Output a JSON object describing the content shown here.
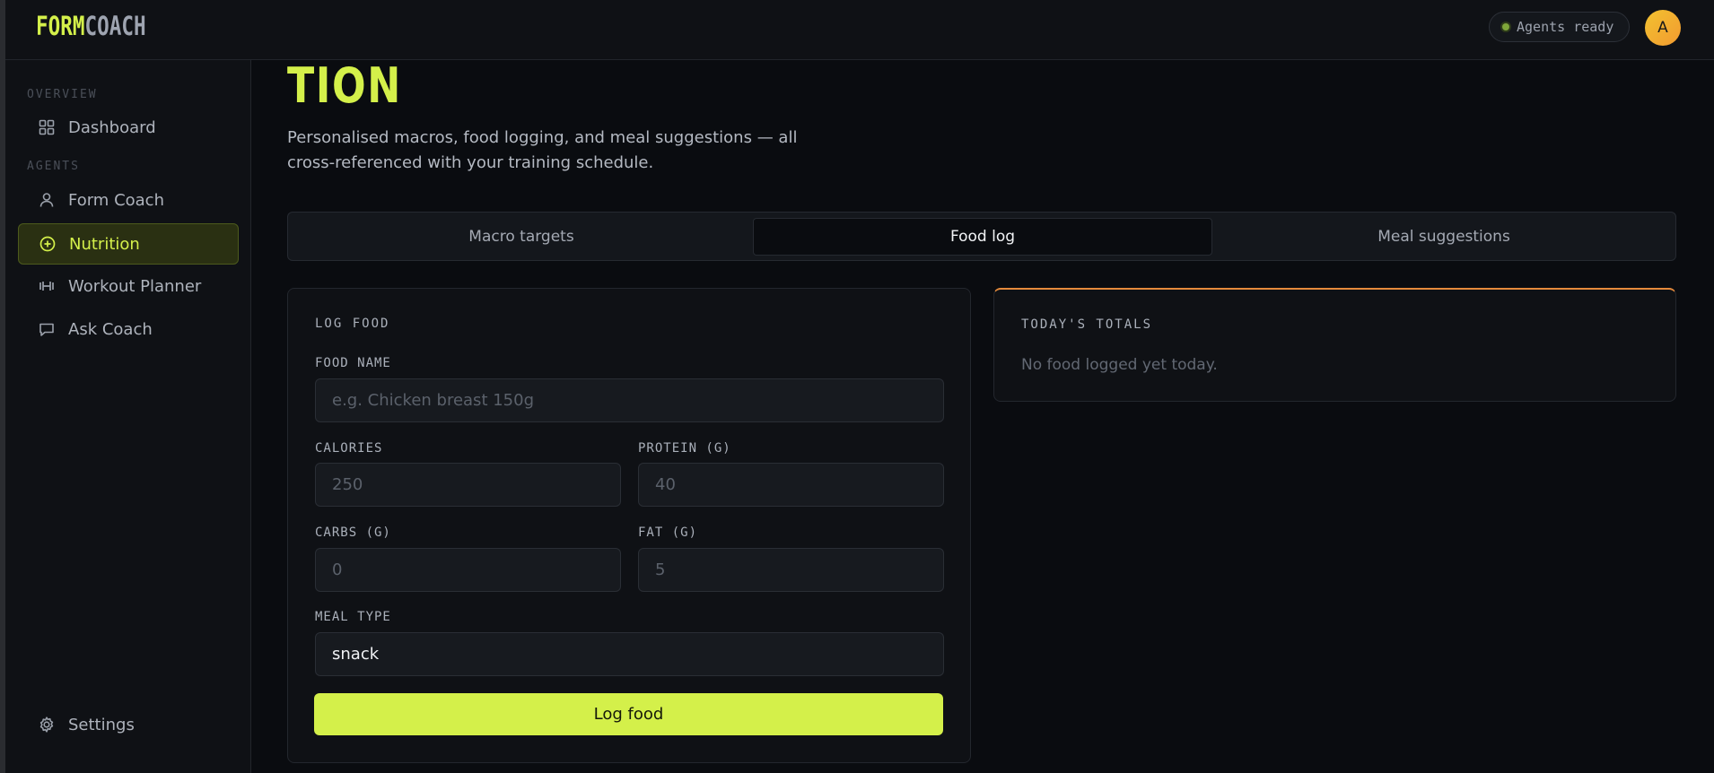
{
  "app": {
    "logo_part1": "FORM",
    "logo_part2": "COACH",
    "status": "Agents ready",
    "avatar_initial": "A"
  },
  "sidebar": {
    "overview_label": "OVERVIEW",
    "agents_label": "AGENTS",
    "items": [
      {
        "label": "Dashboard",
        "icon": "grid-icon"
      },
      {
        "label": "Form Coach",
        "icon": "user-icon"
      },
      {
        "label": "Nutrition",
        "icon": "plus-circle-icon",
        "active": true
      },
      {
        "label": "Workout Planner",
        "icon": "dumbbell-icon"
      },
      {
        "label": "Ask Coach",
        "icon": "chat-icon"
      }
    ],
    "settings_label": "Settings"
  },
  "page": {
    "heading": "TION",
    "description": "Personalised macros, food logging, and meal suggestions — all cross-referenced with your training schedule."
  },
  "tabs": [
    {
      "label": "Macro targets"
    },
    {
      "label": "Food log",
      "active": true
    },
    {
      "label": "Meal suggestions"
    }
  ],
  "log_form": {
    "title": "LOG FOOD",
    "food_name_label": "FOOD NAME",
    "food_name_placeholder": "e.g. Chicken breast 150g",
    "calories_label": "CALORIES",
    "calories_placeholder": "250",
    "protein_label": "PROTEIN (G)",
    "protein_placeholder": "40",
    "carbs_label": "CARBS (G)",
    "carbs_placeholder": "0",
    "fat_label": "FAT (G)",
    "fat_placeholder": "5",
    "meal_type_label": "MEAL TYPE",
    "meal_type_value": "snack",
    "submit_label": "Log food"
  },
  "totals": {
    "title": "TODAY'S TOTALS",
    "empty_message": "No food logged yet today."
  },
  "colors": {
    "accent": "#d4f04a",
    "totals_border": "#e58a3c",
    "status_dot": "#7fa63a",
    "avatar": "#f2b230"
  }
}
